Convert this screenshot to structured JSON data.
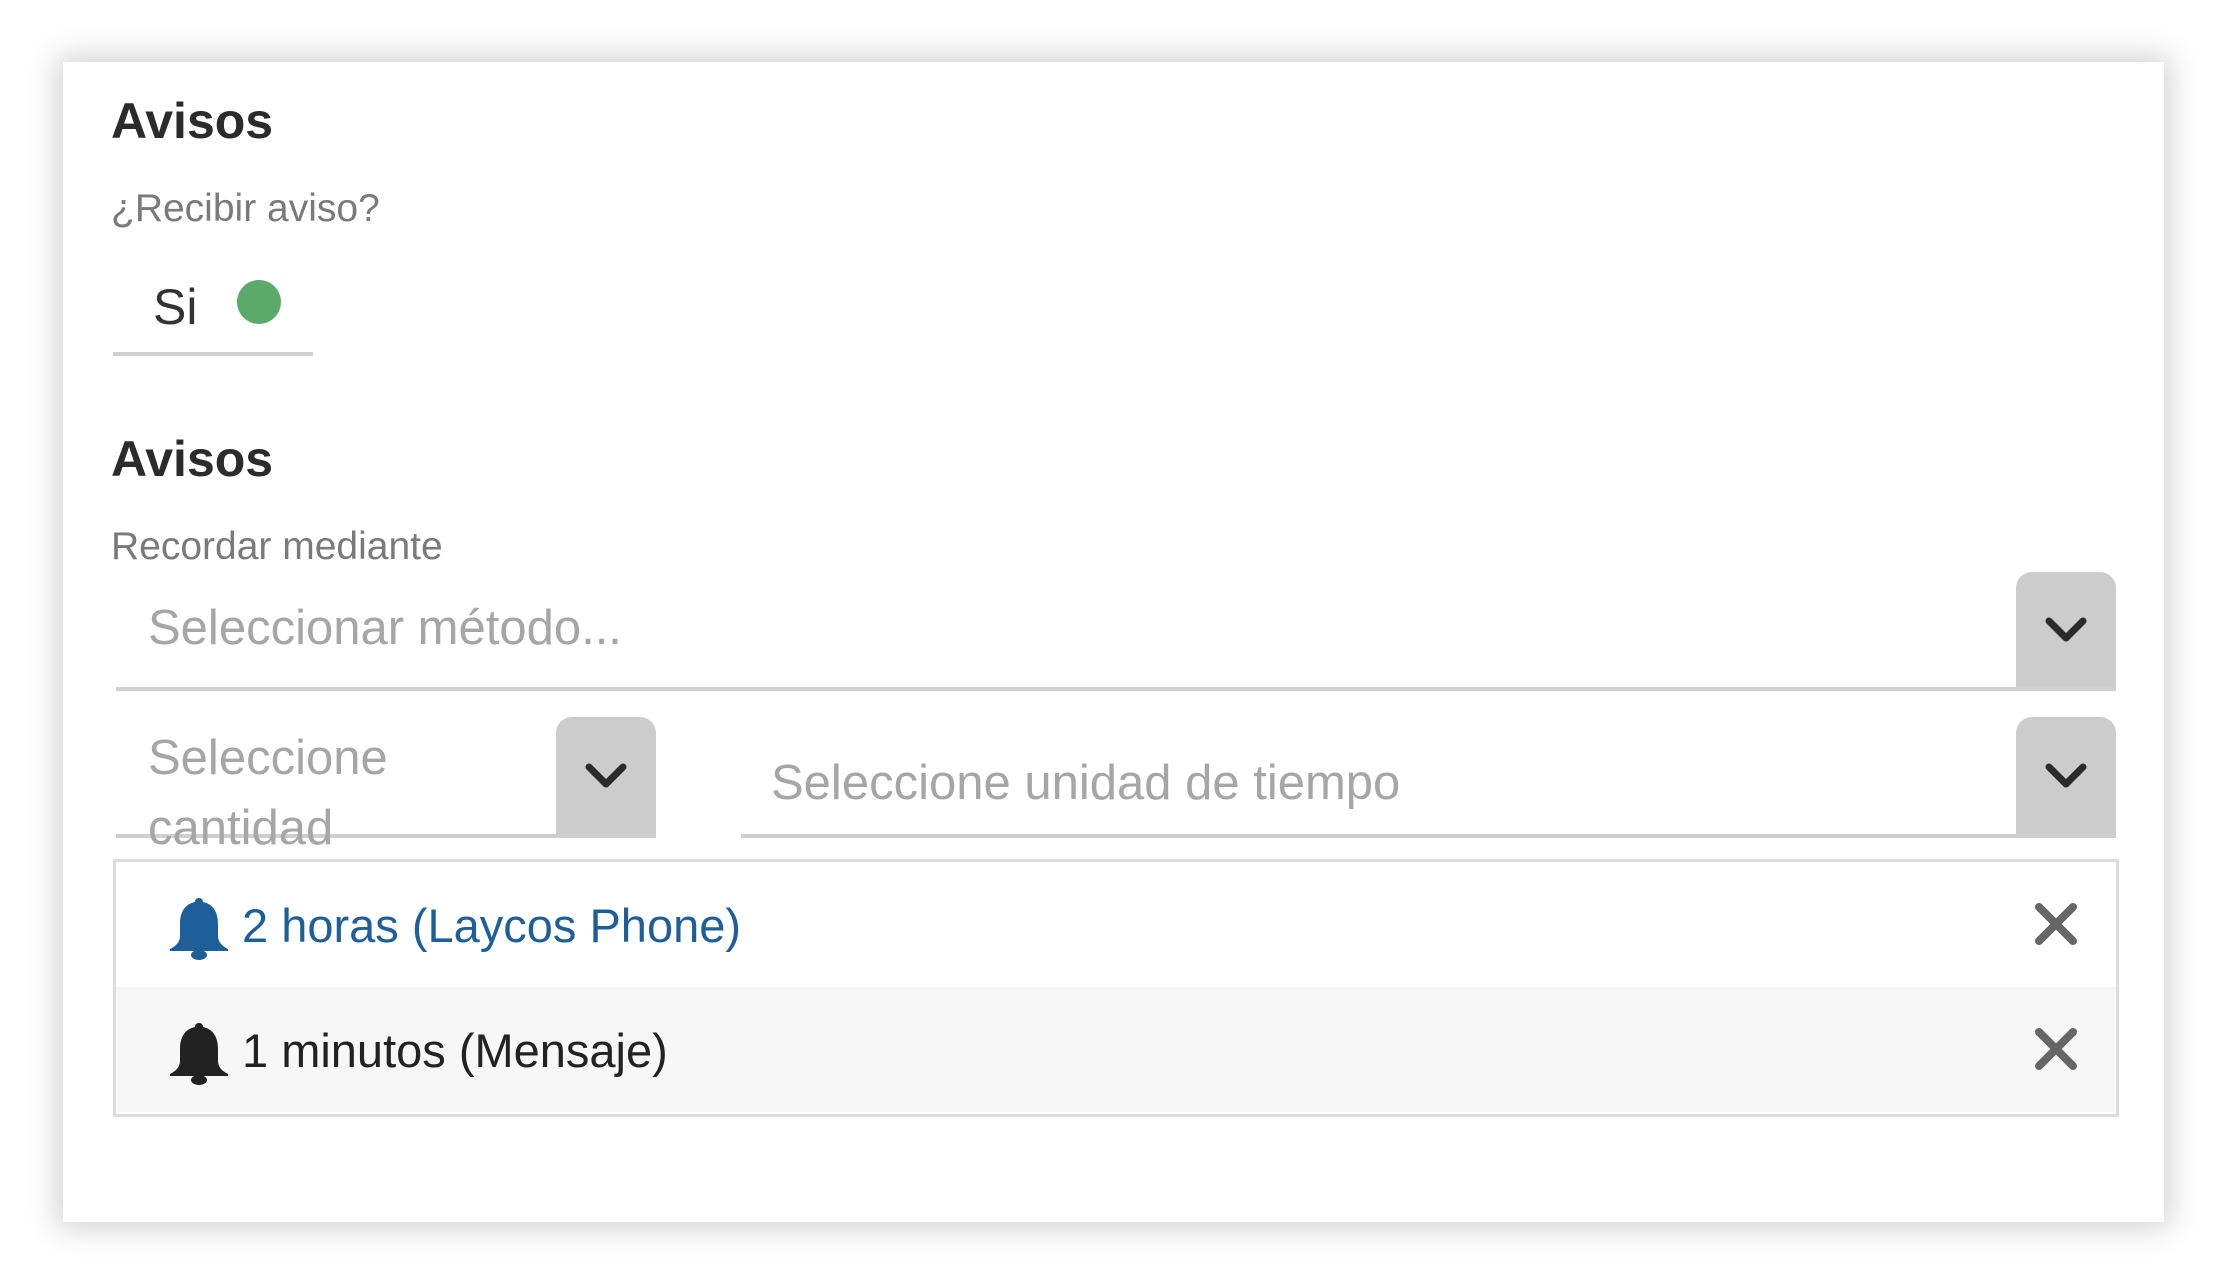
{
  "section1": {
    "title": "Avisos",
    "question_label": "¿Recibir aviso?",
    "toggle": {
      "label": "Si",
      "on": true,
      "dot_color": "#5aaa6b"
    }
  },
  "section2": {
    "title": "Avisos",
    "method_label": "Recordar mediante",
    "method_placeholder": "Seleccionar método...",
    "quantity_placeholder": "Seleccione cantidad",
    "unit_placeholder": "Seleccione unidad de tiempo"
  },
  "reminders": [
    {
      "text": "2 horas (Laycos Phone)",
      "color": "#1f5f99",
      "icon": "bell-icon",
      "remove_icon": "close-icon"
    },
    {
      "text": "1 minutos (Mensaje)",
      "color": "#222222",
      "icon": "bell-icon",
      "remove_icon": "close-icon"
    }
  ],
  "colors": {
    "accent_blue": "#1f5f99",
    "toggle_on": "#5aaa6b",
    "select_button": "#cccccc",
    "remove_icon": "#666666"
  }
}
